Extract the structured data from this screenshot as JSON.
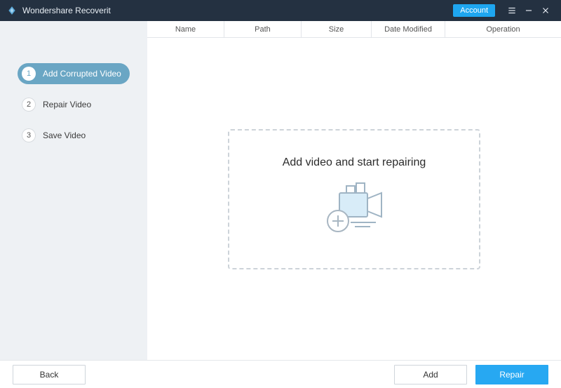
{
  "titlebar": {
    "app_title": "Wondershare Recoverit",
    "account_label": "Account"
  },
  "sidebar": {
    "steps": [
      {
        "num": "1",
        "label": "Add Corrupted Video",
        "active": true
      },
      {
        "num": "2",
        "label": "Repair Video",
        "active": false
      },
      {
        "num": "3",
        "label": "Save Video",
        "active": false
      }
    ]
  },
  "columns": {
    "name": "Name",
    "path": "Path",
    "size": "Size",
    "date": "Date Modified",
    "operation": "Operation"
  },
  "dropzone": {
    "headline": "Add video and start repairing"
  },
  "footer": {
    "back_label": "Back",
    "add_label": "Add",
    "repair_label": "Repair"
  }
}
